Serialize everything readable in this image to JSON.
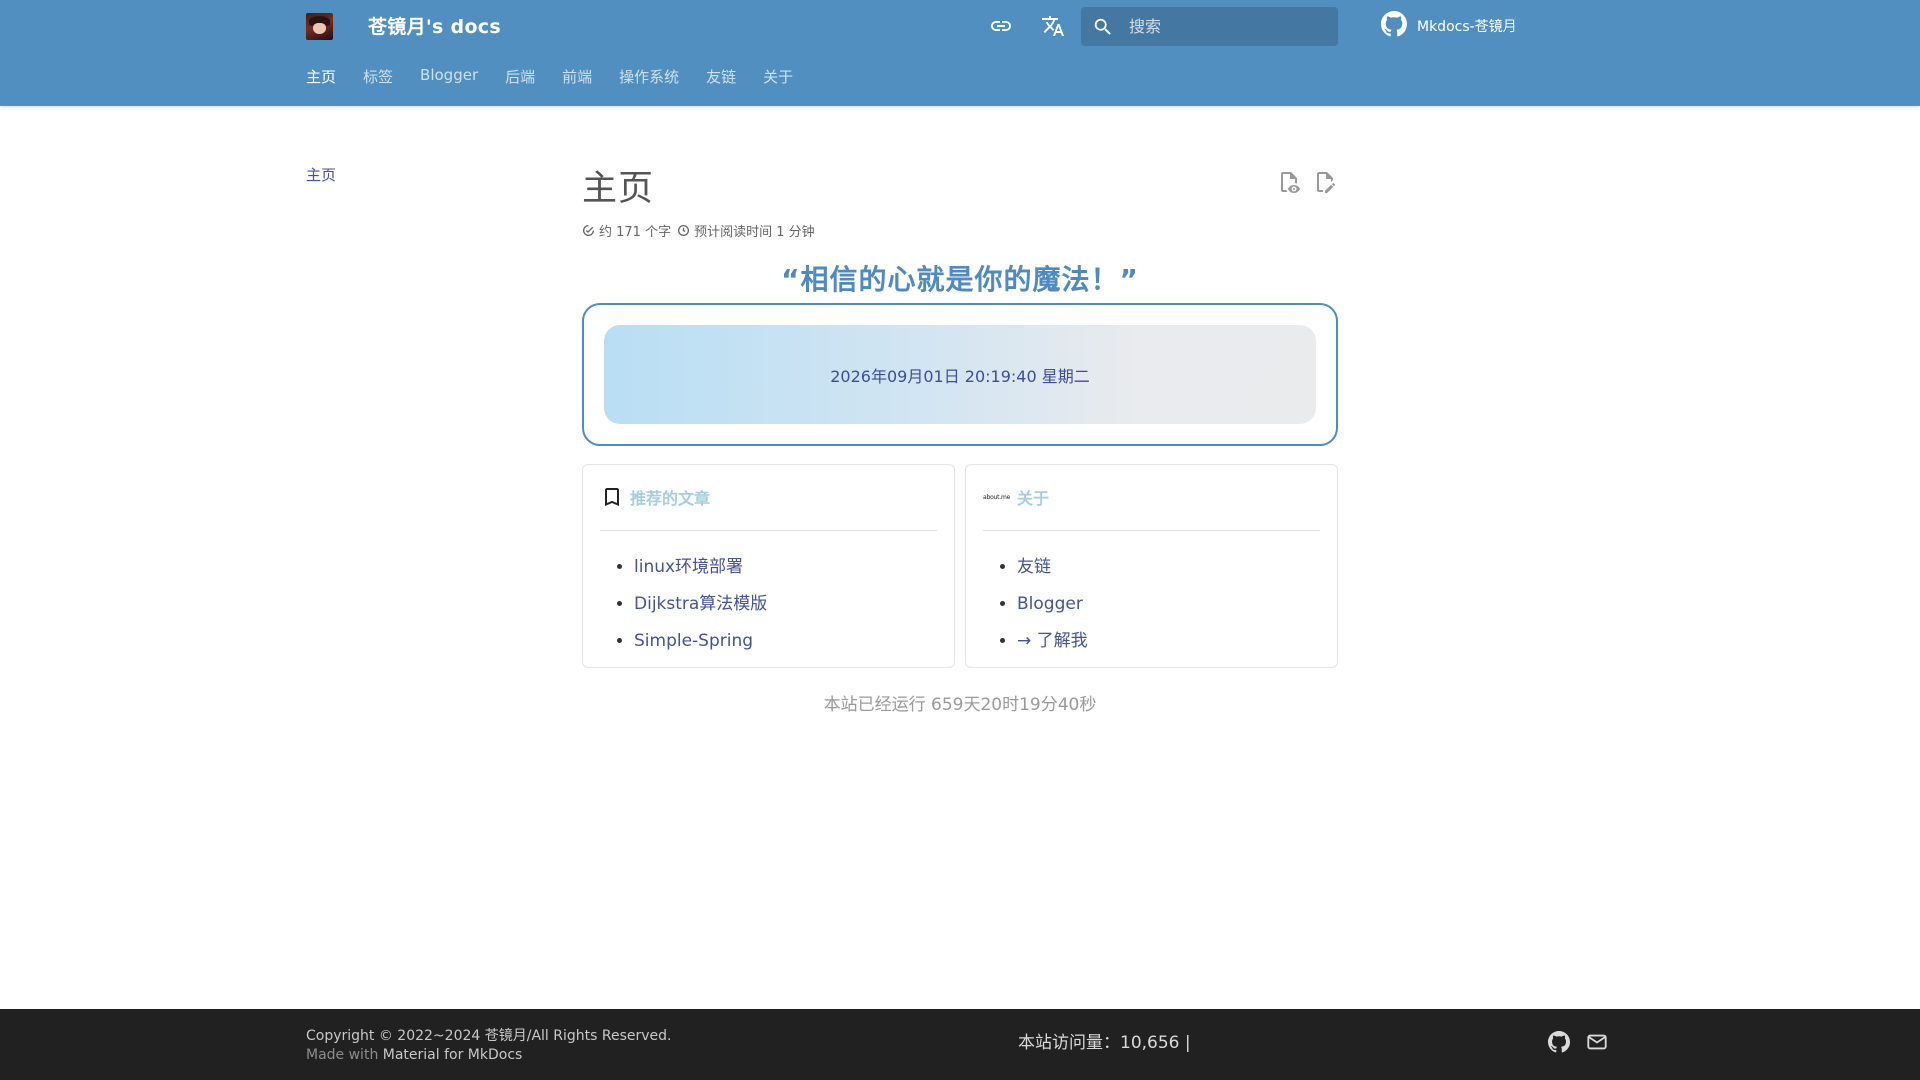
{
  "header": {
    "site_title": "苍镜月's docs",
    "search_placeholder": "搜索",
    "repo_label": "Mkdocs-苍镜月",
    "tabs": [
      {
        "label": "主页",
        "active": true
      },
      {
        "label": "标签",
        "active": false
      },
      {
        "label": "Blogger",
        "active": false
      },
      {
        "label": "后端",
        "active": false
      },
      {
        "label": "前端",
        "active": false
      },
      {
        "label": "操作系统",
        "active": false
      },
      {
        "label": "友链",
        "active": false
      },
      {
        "label": "关于",
        "active": false
      }
    ]
  },
  "sidebar": {
    "item_label": "主页"
  },
  "main": {
    "title": "主页",
    "meta": {
      "word_count": "约 171 个字",
      "read_time": "预计阅读时间 1 分钟"
    },
    "quote": "“相信的心就是你的魔法！”",
    "clock": "2026年09月01日 20:19:40 星期二",
    "cards": {
      "recommended": {
        "title": "推荐的文章",
        "items": [
          "linux环境部署",
          "Dijkstra算法模版",
          "Simple-Spring"
        ]
      },
      "about": {
        "logo_text": "about.me",
        "title": "关于",
        "items": [
          "友链",
          "Blogger",
          "→ 了解我"
        ]
      }
    },
    "runtime": "本站已经运行 659天20时19分40秒"
  },
  "footer": {
    "copyright": "Copyright © 2022~2024 苍镜月/All Rights Reserved.",
    "made_with_prefix": "Made with",
    "made_with_link": "Material for MkDocs",
    "visits": "本站访问量：10,656 |"
  },
  "colors": {
    "primary": "#518fc1",
    "accent_link": "#4452a0",
    "quote": "#4f8bc0",
    "card_title": "#a3cfe0",
    "footer_bg": "#212121"
  },
  "icons": {
    "link": "link-icon",
    "translate": "translate-icon",
    "search": "search-icon",
    "github": "github-icon",
    "view_source": "view-source-icon",
    "edit": "edit-icon",
    "bookmark": "bookmark-icon",
    "mail": "mail-icon"
  }
}
